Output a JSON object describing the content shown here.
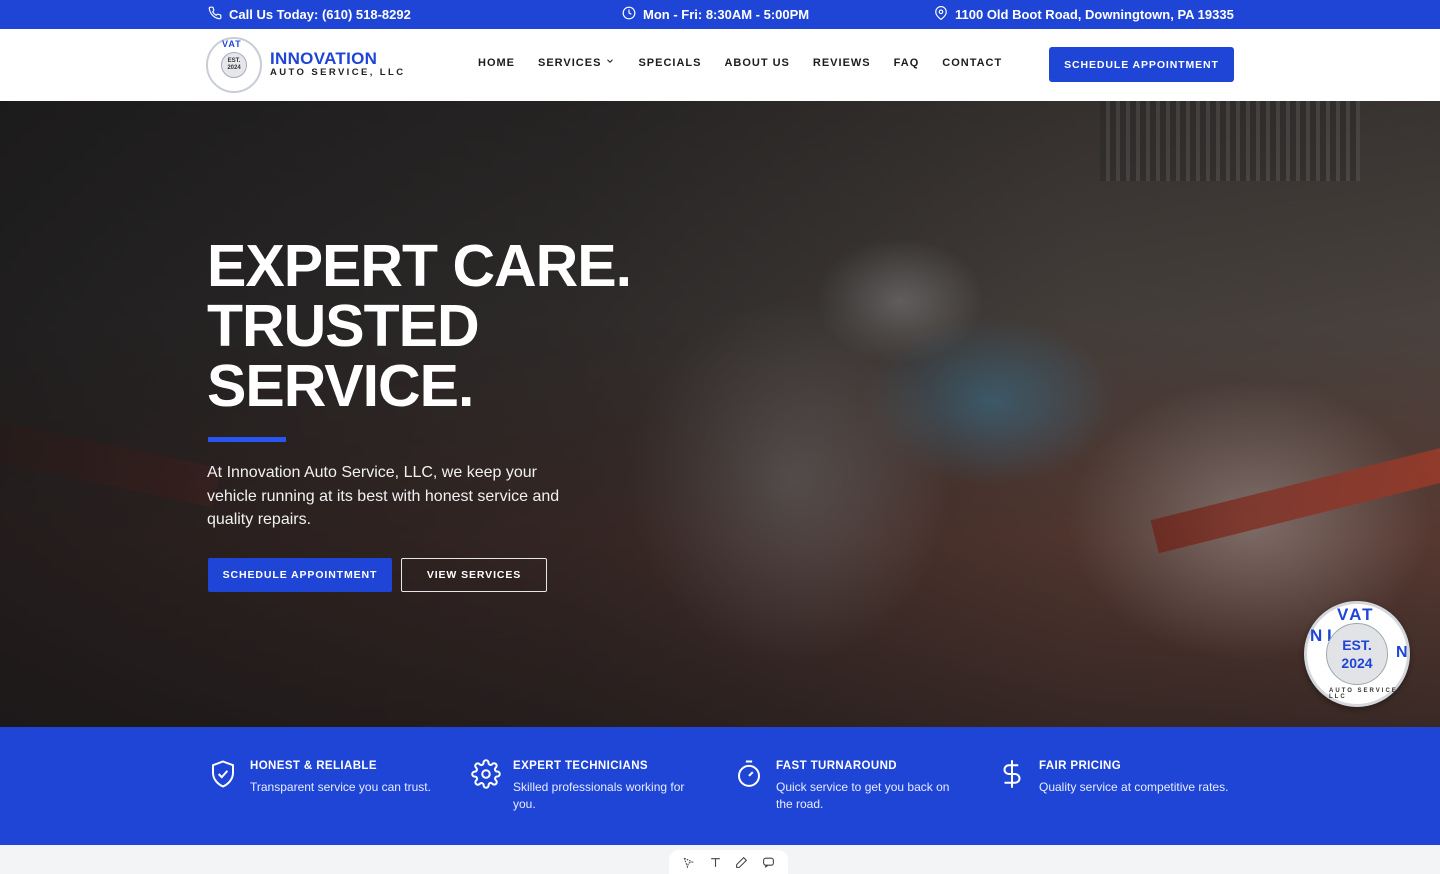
{
  "topbar": {
    "phone": "Call Us Today: (610) 518-8292",
    "hours": "Mon - Fri: 8:30AM - 5:00PM",
    "address": "1100 Old Boot Road, Downingtown, PA 19335"
  },
  "header": {
    "logo": {
      "est": "EST.",
      "year": "2024",
      "arc": "VAT"
    },
    "brand_name": "INNOVATION",
    "brand_sub": "AUTO SERVICE, LLC",
    "nav": [
      {
        "label": "HOME"
      },
      {
        "label": "SERVICES"
      },
      {
        "label": "SPECIALS"
      },
      {
        "label": "ABOUT US"
      },
      {
        "label": "REVIEWS"
      },
      {
        "label": "FAQ"
      },
      {
        "label": "CONTACT"
      }
    ],
    "cta_label": "SCHEDULE APPOINTMENT"
  },
  "hero": {
    "title_lines": [
      "EXPERT CARE.",
      "TRUSTED",
      "SERVICE."
    ],
    "text": "At Innovation Auto Service, LLC, we keep your vehicle running at its best with honest service and quality repairs.",
    "primary_label": "SCHEDULE APPOINTMENT",
    "secondary_label": "VIEW SERVICES",
    "badge": {
      "top": "VAT",
      "left": "N I",
      "right": "N",
      "est": "EST.",
      "year": "2024",
      "bottom": "AUTO SERVICE, LLC"
    }
  },
  "features": [
    {
      "icon": "shield-check-icon",
      "title": "HONEST & RELIABLE",
      "text": "Transparent service you can trust."
    },
    {
      "icon": "gear-icon",
      "title": "EXPERT TECHNICIANS",
      "text": "Skilled professionals working for you."
    },
    {
      "icon": "stopwatch-icon",
      "title": "FAST TURNAROUND",
      "text": "Quick service to get you back on the road."
    },
    {
      "icon": "dollar-icon",
      "title": "FAIR PRICING",
      "text": "Quality service at competitive rates."
    }
  ],
  "colors": {
    "brand": "#1f45d6",
    "accent": "#2a55f0"
  },
  "toolbar": {
    "icons": [
      "select-icon",
      "text-icon",
      "pen-icon",
      "comment-icon"
    ]
  }
}
